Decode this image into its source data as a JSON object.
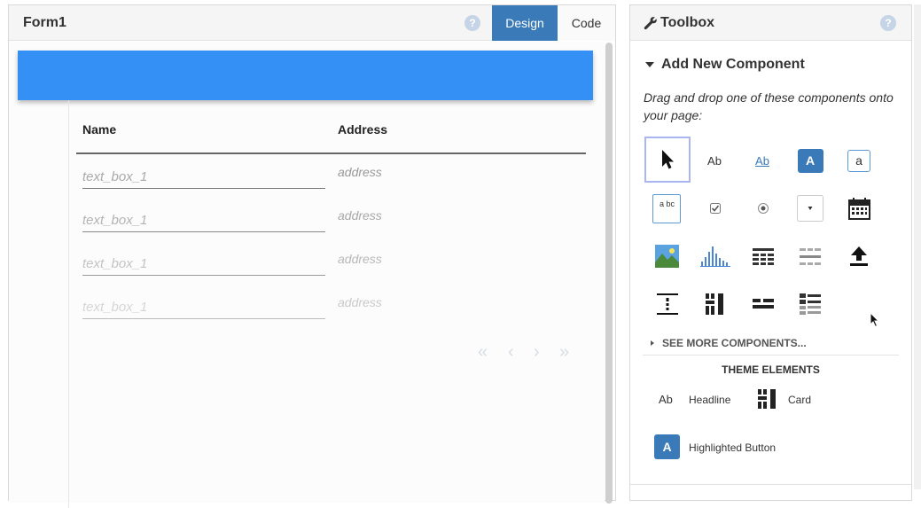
{
  "form": {
    "title": "Form1",
    "help_icon": "?",
    "tabs": [
      {
        "label": "Design",
        "active": true
      },
      {
        "label": "Code",
        "active": false
      }
    ],
    "navbar_color": "#3490f5"
  },
  "grid": {
    "columns": [
      "Name",
      "Address"
    ],
    "rows": [
      {
        "name_placeholder": "text_box_1",
        "address": "address"
      },
      {
        "name_placeholder": "text_box_1",
        "address": "address"
      },
      {
        "name_placeholder": "text_box_1",
        "address": "address"
      },
      {
        "name_placeholder": "text_box_1",
        "address": "address"
      }
    ],
    "pager": [
      "«",
      "‹",
      "›",
      "»"
    ]
  },
  "toolbox": {
    "title": "Toolbox",
    "help_icon": "?",
    "section_title": "Add New Component",
    "hint": "Drag and drop one of these components onto your page:",
    "components": [
      {
        "icon": "pointer-icon"
      },
      {
        "icon": "label-icon",
        "text": "Ab"
      },
      {
        "icon": "link-icon",
        "text": "Ab"
      },
      {
        "icon": "button-icon",
        "text": "A"
      },
      {
        "icon": "textbox-icon",
        "text": "a"
      },
      {
        "icon": "textarea-icon",
        "text": "a bc"
      },
      {
        "icon": "checkbox-icon"
      },
      {
        "icon": "radio-button-icon"
      },
      {
        "icon": "dropdown-icon"
      },
      {
        "icon": "date-picker-icon"
      },
      {
        "icon": "image-icon"
      },
      {
        "icon": "plot-icon"
      },
      {
        "icon": "data-grid-icon"
      },
      {
        "icon": "repeating-panel-icon"
      },
      {
        "icon": "file-loader-icon"
      },
      {
        "icon": "spacer-icon"
      },
      {
        "icon": "column-panel-icon"
      },
      {
        "icon": "linear-panel-icon"
      },
      {
        "icon": "flow-panel-icon"
      }
    ],
    "see_more": "SEE MORE COMPONENTS...",
    "theme_title": "THEME ELEMENTS",
    "theme_items": [
      {
        "icon": "headline-icon",
        "icon_text": "Ab",
        "label": "Headline"
      },
      {
        "icon": "card-icon",
        "label": "Card"
      },
      {
        "icon": "highlighted-button-icon",
        "icon_text": "A",
        "label": "Highlighted Button"
      }
    ]
  }
}
